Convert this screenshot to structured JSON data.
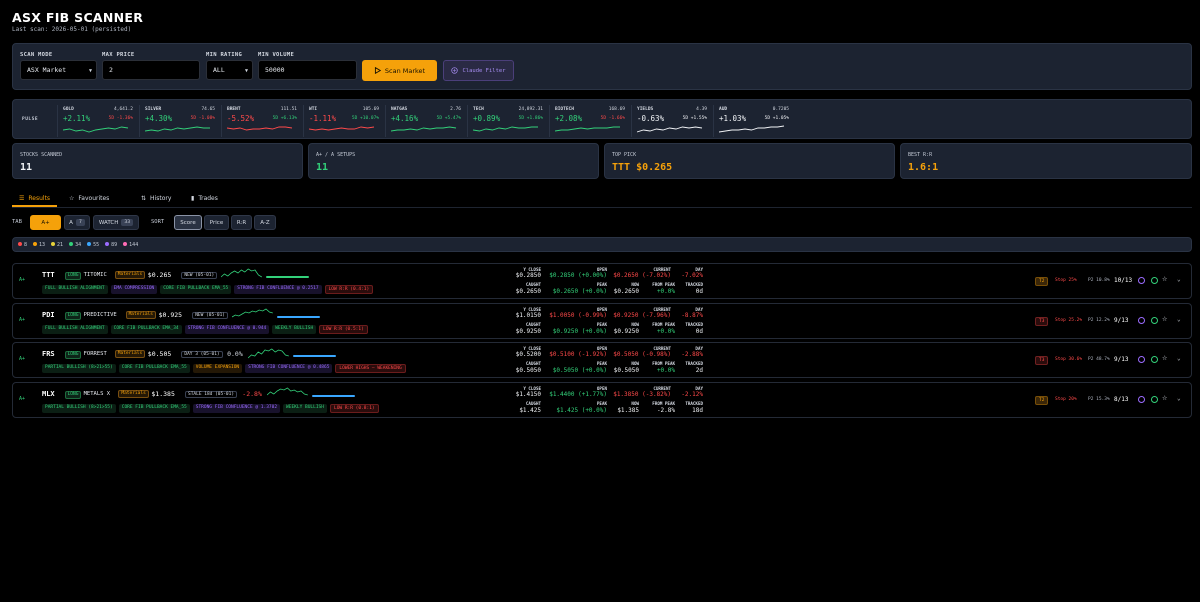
{
  "app": {
    "title": "ASX FIB SCANNER",
    "subtitle": "Last scan: 2026-05-01 (persisted)"
  },
  "controls": {
    "scan_mode_label": "SCAN MODE",
    "scan_mode_value": "ASX Market",
    "max_price_label": "MAX PRICE",
    "max_price_value": "2",
    "min_rating_label": "MIN RATING",
    "min_rating_value": "ALL",
    "min_volume_label": "MIN VOLUME",
    "min_volume_value": "50000",
    "scan_button": "Scan Market",
    "claude_button": "Claude Filter"
  },
  "pulse": {
    "label": "PULSE",
    "items": [
      {
        "name": "GOLD",
        "price": "4,641.2",
        "change": "+2.11%",
        "fived": "5D -1.36%",
        "dir": "up",
        "fdir": "dn"
      },
      {
        "name": "SILVER",
        "price": "74.65",
        "change": "+4.30%",
        "fived": "5D -1.08%",
        "dir": "up",
        "fdir": "dn"
      },
      {
        "name": "BRENT",
        "price": "111.51",
        "change": "-5.52%",
        "fived": "5D +6.13%",
        "dir": "dn",
        "fdir": "dn"
      },
      {
        "name": "WTI",
        "price": "105.69",
        "change": "-1.11%",
        "fived": "5D +10.07%",
        "dir": "dn",
        "fdir": "dn"
      },
      {
        "name": "NATGAS",
        "price": "2.76",
        "change": "+4.16%",
        "fived": "5D +5.47%",
        "dir": "up",
        "fdir": "up"
      },
      {
        "name": "TECH",
        "price": "24,892.31",
        "change": "+0.89%",
        "fived": "5D +1.86%",
        "dir": "up",
        "fdir": "up"
      },
      {
        "name": "BIOTECH",
        "price": "168.69",
        "change": "+2.08%",
        "fived": "5D -1.66%",
        "dir": "up",
        "fdir": "up"
      },
      {
        "name": "YIELDS",
        "price": "4.39",
        "change": "-0.63%",
        "fived": "5D +1.55%",
        "dir": "neutral",
        "fdir": "neutral"
      },
      {
        "name": "AUD",
        "price": "0.7205",
        "change": "+1.03%",
        "fived": "5D +1.05%",
        "dir": "neutral",
        "fdir": "neutral"
      }
    ]
  },
  "stats": {
    "scanned_label": "STOCKS SCANNED",
    "scanned_value": "11",
    "setups_label": "A+ / A SETUPS",
    "setups_value": "11",
    "top_label": "TOP PICK",
    "top_value": "TTT $0.265",
    "rr_label": "BEST R:R",
    "rr_value": "1.6:1"
  },
  "nav": {
    "results": "Results",
    "favourites": "Favourites",
    "history": "History",
    "trades": "Trades"
  },
  "filters": {
    "tab_label": "TAB",
    "tab_aplus": "A+",
    "tab_a": "A",
    "tab_a_count": "7",
    "tab_watch": "WATCH",
    "tab_watch_count": "33",
    "sort_label": "SORT",
    "sort_score": "Score",
    "sort_price": "Price",
    "sort_rr": "R:R",
    "sort_az": "A-Z"
  },
  "legend": [
    {
      "label": "8",
      "color": "#ff4a4a"
    },
    {
      "label": "13",
      "color": "#f5a10a"
    },
    {
      "label": "21",
      "color": "#e6d23a"
    },
    {
      "label": "34",
      "color": "#33d17a"
    },
    {
      "label": "55",
      "color": "#3aa7ff"
    },
    {
      "label": "89",
      "color": "#9b6bff"
    },
    {
      "label": "144",
      "color": "#ff6bb5"
    }
  ],
  "colheads": {
    "yclose": "Y CLOSE",
    "open": "OPEN",
    "current": "CURRENT",
    "day": "DAY",
    "caught": "CAUGHT",
    "peak": "PEAK",
    "now": "NOW",
    "frompeak": "FROM PEAK",
    "tracked": "TRACKED"
  },
  "rows": [
    {
      "grade": "A+",
      "ticker": "TTT",
      "long": "LONG",
      "name": "TITOMIC",
      "sector": "Materials",
      "price": "$0.265",
      "status": "NEW (05-01)",
      "pct": "",
      "tags": [
        {
          "t": "FULL BULLISH ALIGNMENT",
          "c": "tg"
        },
        {
          "t": "EMA COMPRESSION",
          "c": "tp"
        },
        {
          "t": "CORE FIB PULLBACK EMA_55",
          "c": "tg"
        },
        {
          "t": "STRONG FIB CONFLUENCE @ 0.2517",
          "c": "tp"
        },
        {
          "t": "LOW R:R (0.4:1)",
          "c": "tr"
        }
      ],
      "yclose": "$0.2850",
      "open": "$0.2850 (+0.00%)",
      "current": "$0.2650 (-7.02%)",
      "day": "-7.02%",
      "caught": "$0.2650",
      "peak": "$0.2650 (+0.0%)",
      "now": "$0.2650",
      "frompeak": "+0.0%",
      "tracked": "0d",
      "tier": "T2",
      "stop": "Stop 25%",
      "p2": "P2 10.8%",
      "score": "10/13"
    },
    {
      "grade": "A+",
      "ticker": "PDI",
      "long": "LONG",
      "name": "PREDICTIVE",
      "sector": "Materials",
      "price": "$0.925",
      "status": "NEW (05-01)",
      "pct": "",
      "tags": [
        {
          "t": "FULL BULLISH ALIGNMENT",
          "c": "tg"
        },
        {
          "t": "CORE FIB PULLBACK EMA_34",
          "c": "tg"
        },
        {
          "t": "STRONG FIB CONFLUENCE @ 0.944",
          "c": "tp"
        },
        {
          "t": "WEEKLY BULLISH",
          "c": "tg"
        },
        {
          "t": "LOW R:R (0.5:1)",
          "c": "tr"
        }
      ],
      "yclose": "$1.0150",
      "open": "$1.0050 (-0.99%)",
      "current": "$0.9250 (-7.96%)",
      "day": "-8.87%",
      "caught": "$0.9250",
      "peak": "$0.9250 (+0.0%)",
      "now": "$0.9250",
      "frompeak": "+0.0%",
      "tracked": "0d",
      "tier": "T3",
      "stop": "Stop 25.2%",
      "p2": "P2 12.2%",
      "score": "9/13"
    },
    {
      "grade": "A+",
      "ticker": "FRS",
      "long": "LONG",
      "name": "FORREST",
      "sector": "Materials",
      "price": "$0.505",
      "status": "DAY 3 (05-01)",
      "pct": "0.0%",
      "tags": [
        {
          "t": "PARTIAL BULLISH (8>21>55)",
          "c": "tg"
        },
        {
          "t": "CORE FIB PULLBACK EMA_55",
          "c": "tg"
        },
        {
          "t": "VOLUME EXPANSION",
          "c": "to"
        },
        {
          "t": "STRONG FIB CONFLUENCE @ 0.4865",
          "c": "tp"
        },
        {
          "t": "LOWER HIGHS — WEAKENING",
          "c": "tr"
        }
      ],
      "yclose": "$0.5200",
      "open": "$0.5100 (-1.92%)",
      "current": "$0.5050 (-0.98%)",
      "day": "-2.88%",
      "caught": "$0.5050",
      "peak": "$0.5050 (+0.0%)",
      "now": "$0.5050",
      "frompeak": "+0.0%",
      "tracked": "2d",
      "tier": "T3",
      "stop": "Stop 30.6%",
      "p2": "P2 48.7%",
      "score": "9/13"
    },
    {
      "grade": "A+",
      "ticker": "MLX",
      "long": "LONG",
      "name": "METALS X",
      "sector": "Materials",
      "price": "$1.385",
      "status": "STALE 18d (05-01)",
      "pct": "-2.8%",
      "tags": [
        {
          "t": "PARTIAL BULLISH (8>21>55)",
          "c": "tg"
        },
        {
          "t": "CORE FIB PULLBACK EMA_55",
          "c": "tg"
        },
        {
          "t": "STRONG FIB CONFLUENCE @ 1.3702",
          "c": "tp"
        },
        {
          "t": "WEEKLY BULLISH",
          "c": "tg"
        },
        {
          "t": "LOW R:R (0.8:1)",
          "c": "tr"
        }
      ],
      "yclose": "$1.4150",
      "open": "$1.4400 (+1.77%)",
      "current": "$1.3850 (-3.82%)",
      "day": "-2.12%",
      "caught": "$1.425",
      "peak": "$1.425 (+0.0%)",
      "now": "$1.385",
      "frompeak": "-2.8%",
      "tracked": "18d",
      "tier": "T2",
      "stop": "Stop 20%",
      "p2": "P2 15.3%",
      "score": "8/13"
    }
  ]
}
